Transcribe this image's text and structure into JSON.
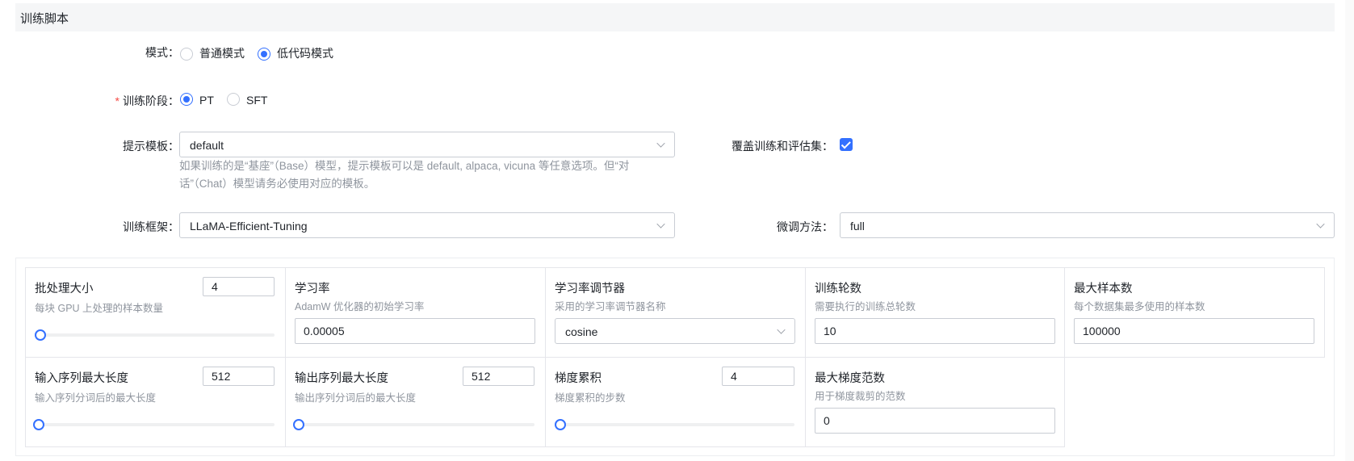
{
  "section": {
    "title": "训练脚本"
  },
  "mode": {
    "label": "模式：",
    "options": [
      {
        "label": "普通模式",
        "selected": false
      },
      {
        "label": "低代码模式",
        "selected": true
      }
    ]
  },
  "stage": {
    "required_mark": "*",
    "label": "训练阶段：",
    "options": [
      {
        "label": "PT",
        "selected": true
      },
      {
        "label": "SFT",
        "selected": false
      }
    ]
  },
  "prompt_template": {
    "label": "提示模板：",
    "value": "default",
    "hint_line1": "如果训练的是“基座”（Base）模型，提示模板可以是 default, alpaca, vicuna 等任意选项。但“对",
    "hint_line2": "话”（Chat）模型请务必使用对应的模板。"
  },
  "override_sets": {
    "label": "覆盖训练和评估集：",
    "checked": true
  },
  "framework": {
    "label": "训练框架：",
    "value": "LLaMA-Efficient-Tuning"
  },
  "finetune_method": {
    "label": "微调方法：",
    "value": "full"
  },
  "params": {
    "batch_size": {
      "title": "批处理大小",
      "desc": "每块 GPU 上处理的样本数量",
      "value": "4",
      "slider_fraction": 0
    },
    "learning_rate": {
      "title": "学习率",
      "desc": "AdamW 优化器的初始学习率",
      "value": "0.00005"
    },
    "lr_scheduler": {
      "title": "学习率调节器",
      "desc": "采用的学习率调节器名称",
      "value": "cosine"
    },
    "epochs": {
      "title": "训练轮数",
      "desc": "需要执行的训练总轮数",
      "value": "10"
    },
    "max_samples": {
      "title": "最大样本数",
      "desc": "每个数据集最多使用的样本数",
      "value": "100000"
    },
    "max_source_length": {
      "title": "输入序列最大长度",
      "desc": "输入序列分词后的最大长度",
      "value": "512",
      "slider_fraction": 0
    },
    "max_target_length": {
      "title": "输出序列最大长度",
      "desc": "输出序列分词后的最大长度",
      "value": "512",
      "slider_fraction": 0
    },
    "grad_accum": {
      "title": "梯度累积",
      "desc": "梯度累积的步数",
      "value": "4",
      "slider_fraction": 0
    },
    "max_grad_norm": {
      "title": "最大梯度范数",
      "desc": "用于梯度裁剪的范数",
      "value": "0"
    }
  },
  "colors": {
    "accent": "#3370ff",
    "border": "#c9cdd4",
    "hint": "#8f959e",
    "header_bg": "#f5f6f7",
    "required": "#f54a45"
  }
}
